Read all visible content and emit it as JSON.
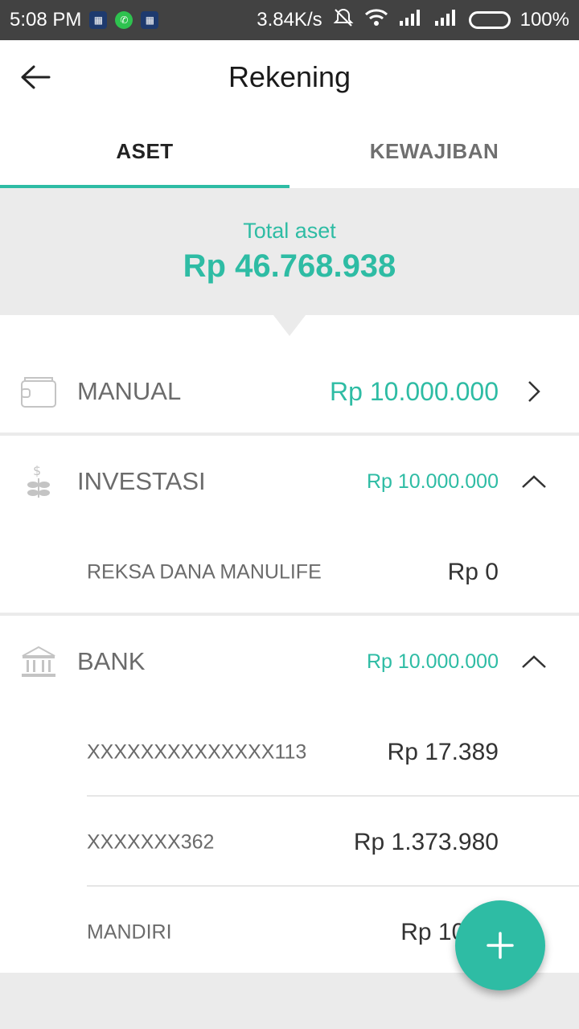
{
  "status_bar": {
    "time": "5:08 PM",
    "network_speed": "3.84K/s",
    "battery_percent": "100%"
  },
  "app_bar": {
    "title": "Rekening"
  },
  "tabs": [
    {
      "label": "ASET",
      "active": true
    },
    {
      "label": "KEWAJIBAN",
      "active": false
    }
  ],
  "summary": {
    "label": "Total aset",
    "value": "Rp 46.768.938"
  },
  "sections": {
    "manual": {
      "name": "MANUAL",
      "amount": "Rp 10.000.000",
      "icon": "wallet-icon",
      "chevron": "chevron-right-icon"
    },
    "investasi": {
      "name": "INVESTASI",
      "amount": "Rp 10.000.000",
      "icon": "money-plant-icon",
      "chevron": "chevron-up-icon",
      "items": [
        {
          "name": "REKSA DANA MANULIFE",
          "amount": "Rp 0"
        }
      ]
    },
    "bank": {
      "name": "BANK",
      "amount": "Rp 10.000.000",
      "icon": "bank-icon",
      "chevron": "chevron-up-icon",
      "items": [
        {
          "name": "XXXXXXXXXXXXXX113",
          "amount": "Rp 17.389"
        },
        {
          "name": "XXXXXXX362",
          "amount": "Rp 1.373.980"
        },
        {
          "name": "MANDIRI",
          "amount": "Rp 101.3"
        }
      ]
    }
  },
  "fab": {
    "icon": "plus-icon"
  },
  "colors": {
    "accent": "#2ebca4",
    "status_bar": "#424242",
    "background": "#ebebeb"
  }
}
